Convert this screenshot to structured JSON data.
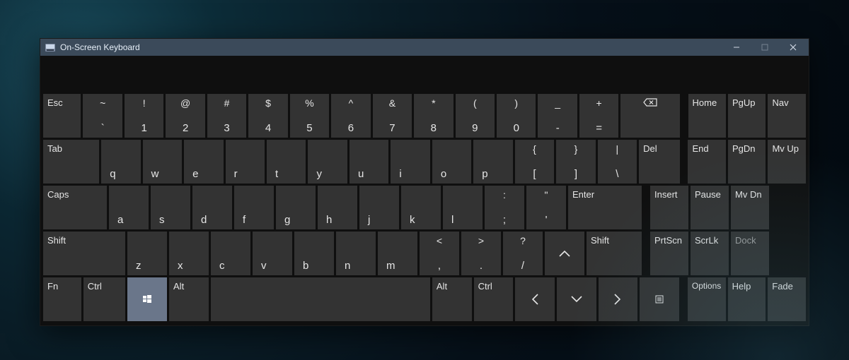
{
  "window": {
    "title": "On-Screen Keyboard",
    "controls": {
      "minimize": "–",
      "maximize": "▢",
      "close": "✕",
      "maximize_enabled": false
    }
  },
  "row1": {
    "esc": "Esc",
    "nums": [
      {
        "top": "~",
        "bottom": "`"
      },
      {
        "top": "!",
        "bottom": "1"
      },
      {
        "top": "@",
        "bottom": "2"
      },
      {
        "top": "#",
        "bottom": "3"
      },
      {
        "top": "$",
        "bottom": "4"
      },
      {
        "top": "%",
        "bottom": "5"
      },
      {
        "top": "^",
        "bottom": "6"
      },
      {
        "top": "&",
        "bottom": "7"
      },
      {
        "top": "*",
        "bottom": "8"
      },
      {
        "top": "(",
        "bottom": "9"
      },
      {
        "top": ")",
        "bottom": "0"
      },
      {
        "top": "_",
        "bottom": "-"
      },
      {
        "top": "+",
        "bottom": "="
      }
    ],
    "backspace": "⌫",
    "side": [
      "Home",
      "PgUp",
      "Nav"
    ]
  },
  "row2": {
    "tab": "Tab",
    "letters": [
      "q",
      "w",
      "e",
      "r",
      "t",
      "y",
      "u",
      "i",
      "o",
      "p"
    ],
    "brackets": [
      {
        "top": "{",
        "bottom": "["
      },
      {
        "top": "}",
        "bottom": "]"
      },
      {
        "top": "|",
        "bottom": "\\"
      }
    ],
    "del": "Del",
    "side": [
      "End",
      "PgDn",
      "Mv Up"
    ]
  },
  "row3": {
    "caps": "Caps",
    "letters": [
      "a",
      "s",
      "d",
      "f",
      "g",
      "h",
      "j",
      "k",
      "l"
    ],
    "punct": [
      {
        "top": ":",
        "bottom": ";"
      },
      {
        "top": "\"",
        "bottom": "'"
      }
    ],
    "enter": "Enter",
    "side": [
      "Insert",
      "Pause",
      "Mv Dn"
    ]
  },
  "row4": {
    "shiftL": "Shift",
    "letters": [
      "z",
      "x",
      "c",
      "v",
      "b",
      "n",
      "m"
    ],
    "punct": [
      {
        "top": "<",
        "bottom": ","
      },
      {
        "top": ">",
        "bottom": "."
      },
      {
        "top": "?",
        "bottom": "/"
      }
    ],
    "up": "˄",
    "shiftR": "Shift",
    "side": [
      "PrtScn",
      "ScrLk",
      "Dock"
    ]
  },
  "row5": {
    "fn": "Fn",
    "ctrlL": "Ctrl",
    "win": "⊞",
    "altL": "Alt",
    "altR": "Alt",
    "ctrlR": "Ctrl",
    "left": "˂",
    "down": "˅",
    "right": "˃",
    "menu": "▤",
    "side": [
      "Options",
      "Help",
      "Fade"
    ]
  }
}
